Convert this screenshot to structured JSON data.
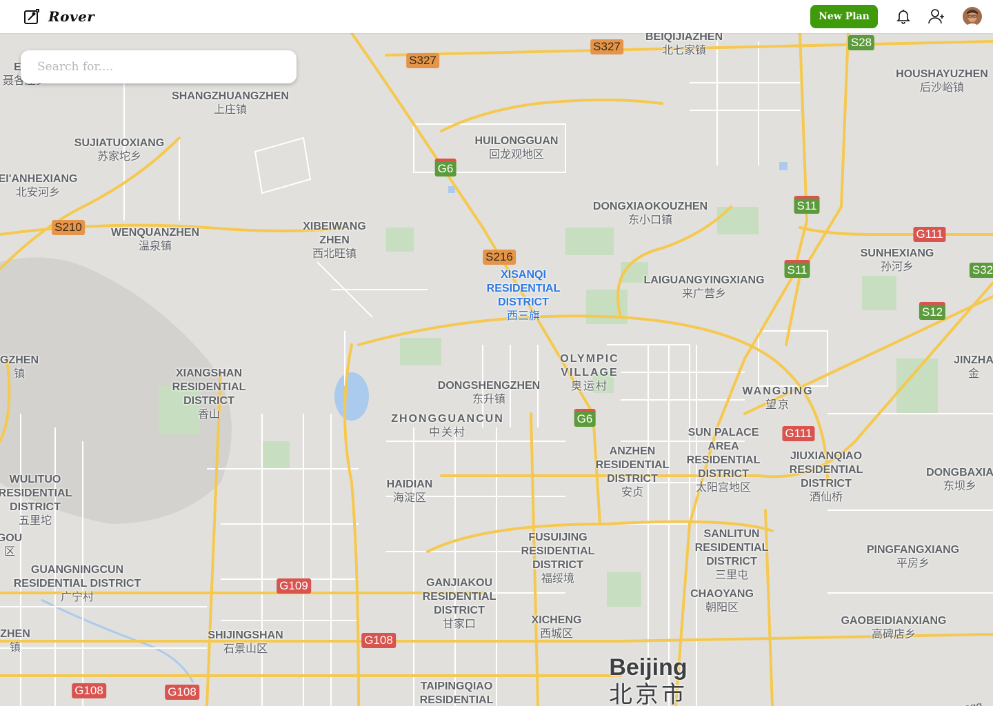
{
  "header": {
    "app_name": "Rover",
    "new_plan_label": "New Plan"
  },
  "search": {
    "placeholder": "Search for...."
  },
  "map": {
    "places": [
      {
        "id": "beiqijiazhen",
        "en": "BEIQIJIAZHEN",
        "zh": "北七家镇"
      },
      {
        "id": "houshayuzhen",
        "en": "HOUSHAYUZHEN",
        "zh": "后沙峪镇"
      },
      {
        "id": "shangzhuangzhen",
        "en": "SHANGZHUANGZHEN",
        "zh": "上庄镇"
      },
      {
        "id": "sujiatuoxiang",
        "en": "SUJIATUOXIANG",
        "zh": "苏家坨乡"
      },
      {
        "id": "huilongguan",
        "en": "HUILONGGUAN",
        "zh": "回龙观地区"
      },
      {
        "id": "beianhexiang",
        "en": "EI'ANHEXIANG",
        "zh": "北安河乡"
      },
      {
        "id": "dongxiaokouzhen",
        "en": "DONGXIAOKOUZHEN",
        "zh": "东小口镇"
      },
      {
        "id": "wenquanzhen",
        "en": "WENQUANZHEN",
        "zh": "温泉镇"
      },
      {
        "id": "xibeiwangzhen",
        "en": "XIBEIWANG\nZHEN",
        "zh": "西北旺镇"
      },
      {
        "id": "sunhexiang",
        "en": "SUNHEXIANG",
        "zh": "孙河乡"
      },
      {
        "id": "xisanqi",
        "en": "XISANQI\nRESIDENTIAL\nDISTRICT",
        "zh": "西三旗"
      },
      {
        "id": "laiguangying",
        "en": "LAIGUANGYINGXIANG",
        "zh": "来广营乡"
      },
      {
        "id": "gzhen",
        "en": "GZHEN",
        "zh": "镇"
      },
      {
        "id": "olympic",
        "en": "OLYMPIC\nVILLAGE",
        "zh": "奥运村"
      },
      {
        "id": "jinzha",
        "en": "JINZHA",
        "zh": "金"
      },
      {
        "id": "xiangshan",
        "en": "XIANGSHAN\nRESIDENTIAL\nDISTRICT",
        "zh": "香山"
      },
      {
        "id": "dongshengzhen",
        "en": "DONGSHENGZHEN",
        "zh": "东升镇"
      },
      {
        "id": "wangjing",
        "en": "WANGJING",
        "zh": "望京"
      },
      {
        "id": "zhongguancun",
        "en": "ZHONGGUANCUN",
        "zh": "中关村"
      },
      {
        "id": "sunpalace",
        "en": "SUN PALACE\nAREA\nRESIDENTIAL\nDISTRICT",
        "zh": "太阳宫地区"
      },
      {
        "id": "anzhen",
        "en": "ANZHEN\nRESIDENTIAL\nDISTRICT",
        "zh": "安贞"
      },
      {
        "id": "jiuxianqiao",
        "en": "JIUXIANQIAO\nRESIDENTIAL\nDISTRICT",
        "zh": "酒仙桥"
      },
      {
        "id": "dongbaxia",
        "en": "DONGBAXIA",
        "zh": "东坝乡"
      },
      {
        "id": "wulituo",
        "en": "WULITUO\nRESIDENTIAL\nDISTRICT",
        "zh": "五里坨"
      },
      {
        "id": "haidian",
        "en": "HAIDIAN",
        "zh": "海淀区"
      },
      {
        "id": "fusuijing",
        "en": "FUSUIJING\nRESIDENTIAL\nDISTRICT",
        "zh": "福绥境"
      },
      {
        "id": "sanlitun",
        "en": "SANLITUN\nRESIDENTIAL\nDISTRICT",
        "zh": "三里屯"
      },
      {
        "id": "pingfang",
        "en": "PINGFANGXIANG",
        "zh": "平房乡"
      },
      {
        "id": "gou",
        "en": "GOU",
        "zh": "区"
      },
      {
        "id": "guangningcun",
        "en": "GUANGNINGCUN\nRESIDENTIAL DISTRICT",
        "zh": "广宁村"
      },
      {
        "id": "ganjiakou",
        "en": "GANJIAKOU\nRESIDENTIAL\nDISTRICT",
        "zh": "甘家口"
      },
      {
        "id": "chaoyang",
        "en": "CHAOYANG",
        "zh": "朝阳区"
      },
      {
        "id": "xicheng",
        "en": "XICHENG",
        "zh": "西城区"
      },
      {
        "id": "gaobeidian",
        "en": "GAOBEIDIANXIANG",
        "zh": "高碑店乡"
      },
      {
        "id": "zhen_left",
        "en": "ZHEN",
        "zh": "镇"
      },
      {
        "id": "shijingshan",
        "en": "SHIJINGSHAN",
        "zh": "石景山区"
      },
      {
        "id": "taipingqiao",
        "en": "TAIPINGQIAO\nRESIDENTIAL",
        "zh": ""
      },
      {
        "id": "ezh",
        "en": "EZH",
        "zh": "聂各庄乡"
      }
    ],
    "city": {
      "en": "Beijing",
      "zh": "北京市"
    },
    "road_name": "Guangq",
    "shields": [
      {
        "label": "S327",
        "type": "orange"
      },
      {
        "label": "S327",
        "type": "orange"
      },
      {
        "label": "S28",
        "type": "green2"
      },
      {
        "label": "G6",
        "type": "green"
      },
      {
        "label": "S11",
        "type": "green"
      },
      {
        "label": "S210",
        "type": "orange"
      },
      {
        "label": "G111",
        "type": "red"
      },
      {
        "label": "S216",
        "type": "orange"
      },
      {
        "label": "S11",
        "type": "green"
      },
      {
        "label": "S32",
        "type": "green2"
      },
      {
        "label": "S12",
        "type": "green"
      },
      {
        "label": "G6",
        "type": "green"
      },
      {
        "label": "G111",
        "type": "red"
      },
      {
        "label": "G109",
        "type": "red"
      },
      {
        "label": "G108",
        "type": "red"
      },
      {
        "label": "G108",
        "type": "red"
      },
      {
        "label": "G108",
        "type": "red"
      }
    ]
  }
}
